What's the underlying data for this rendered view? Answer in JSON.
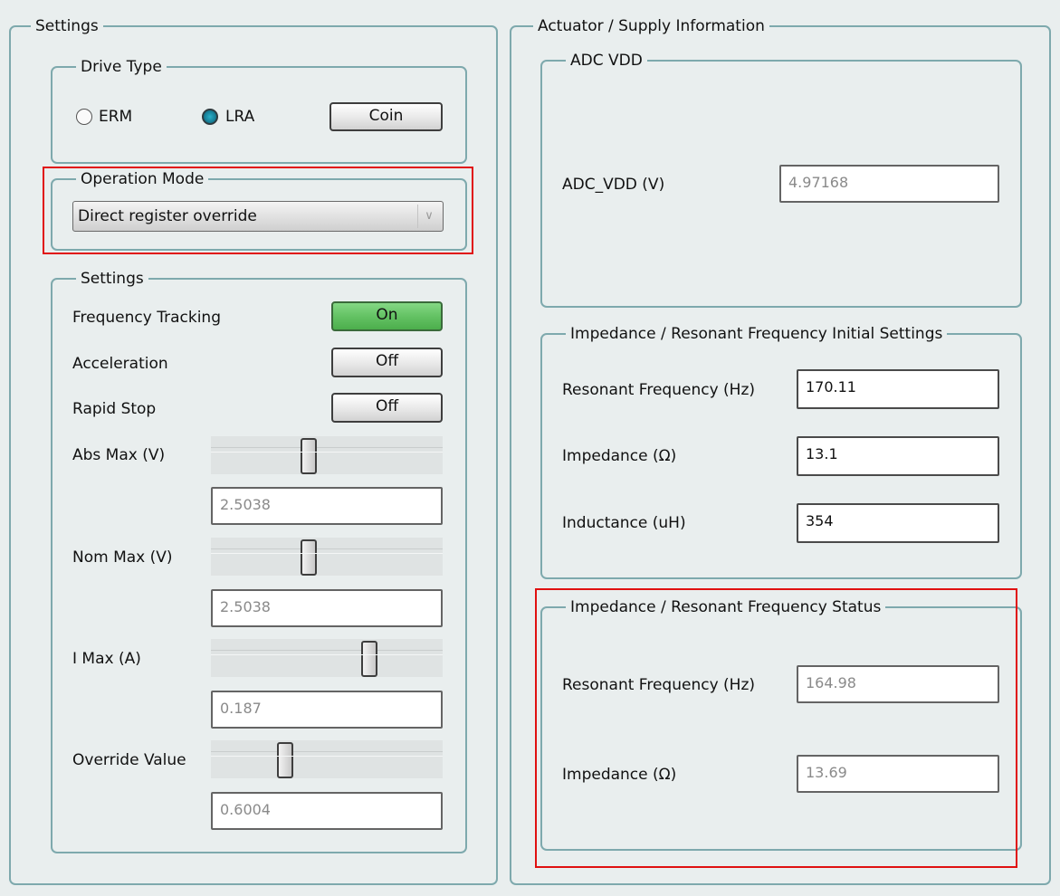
{
  "settings_panel": {
    "title": "Settings",
    "drive_type": {
      "title": "Drive Type",
      "options": [
        {
          "label": "ERM",
          "selected": false
        },
        {
          "label": "LRA",
          "selected": true
        }
      ],
      "coin_button": "Coin"
    },
    "operation_mode": {
      "title": "Operation Mode",
      "selected": "Direct register override",
      "arrow_icon": "chevron-down-icon"
    },
    "settings": {
      "title": "Settings",
      "frequency_tracking": {
        "label": "Frequency Tracking",
        "state": "On"
      },
      "acceleration": {
        "label": "Acceleration",
        "state": "Off"
      },
      "rapid_stop": {
        "label": "Rapid Stop",
        "state": "Off"
      },
      "abs_max": {
        "label": "Abs Max (V)",
        "value": "2.5038"
      },
      "nom_max": {
        "label": "Nom Max (V)",
        "value": "2.5038"
      },
      "i_max": {
        "label": "I Max (A)",
        "value": "0.187"
      },
      "override_value": {
        "label": "Override Value",
        "value": "0.6004"
      }
    }
  },
  "actuator_panel": {
    "title": "Actuator / Supply Information",
    "adc_vdd": {
      "title": "ADC VDD",
      "label": "ADC_VDD (V)",
      "value": "4.97168"
    },
    "initial_settings": {
      "title": "Impedance / Resonant Frequency Initial Settings",
      "resonant_frequency": {
        "label": "Resonant Frequency (Hz)",
        "value": "170.11"
      },
      "impedance": {
        "label": "Impedance (Ω)",
        "value": "13.1"
      },
      "inductance": {
        "label": "Inductance (uH)",
        "value": "354"
      }
    },
    "status": {
      "title": "Impedance / Resonant Frequency Status",
      "resonant_frequency": {
        "label": "Resonant Frequency (Hz)",
        "value": "164.98"
      },
      "impedance": {
        "label": "Impedance (Ω)",
        "value": "13.69"
      }
    }
  },
  "colors": {
    "background": "#e9eeee",
    "group_border": "#7ea9ad",
    "on_button": "#64c264",
    "highlight": "#e01010",
    "radio_selected": "#1b8aa4"
  }
}
